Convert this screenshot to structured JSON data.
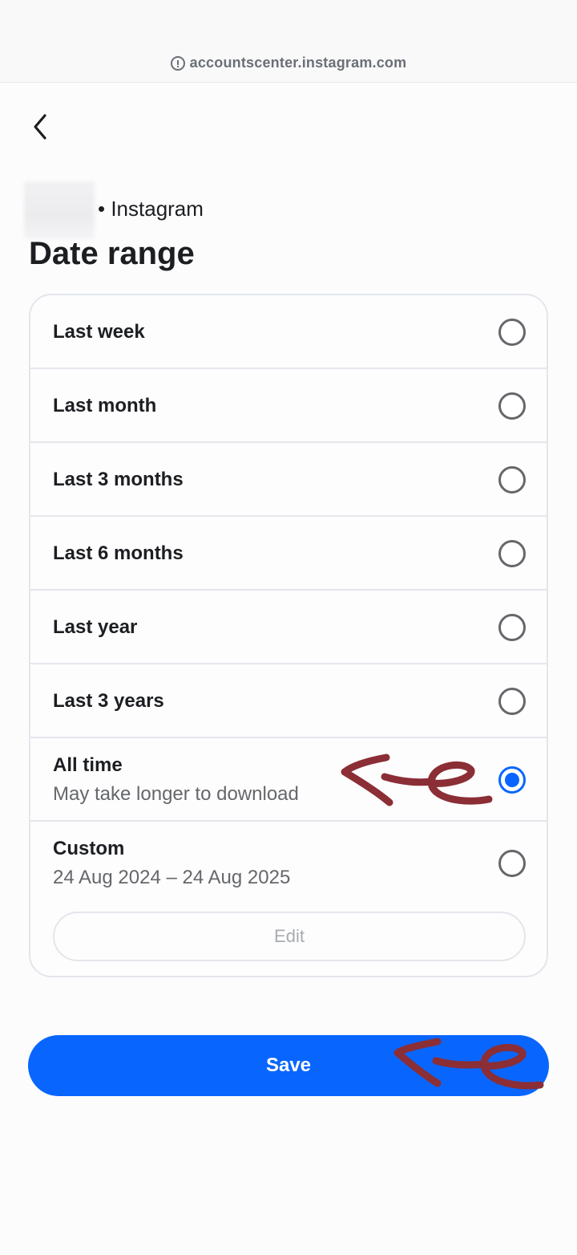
{
  "browser": {
    "url": "accountscenter.instagram.com",
    "info_icon": "info-icon"
  },
  "header": {
    "back_icon": "chevron-left-icon",
    "account_line": "• Instagram",
    "title": "Date range"
  },
  "options": [
    {
      "label": "Last week",
      "sublabel": "",
      "selected": false
    },
    {
      "label": "Last month",
      "sublabel": "",
      "selected": false
    },
    {
      "label": "Last 3 months",
      "sublabel": "",
      "selected": false
    },
    {
      "label": "Last 6 months",
      "sublabel": "",
      "selected": false
    },
    {
      "label": "Last year",
      "sublabel": "",
      "selected": false
    },
    {
      "label": "Last 3 years",
      "sublabel": "",
      "selected": false
    },
    {
      "label": "All time",
      "sublabel": "May take longer to download",
      "selected": true
    },
    {
      "label": "Custom",
      "sublabel": "24 Aug 2024 – 24 Aug 2025",
      "selected": false
    }
  ],
  "custom": {
    "edit_label": "Edit",
    "edit_disabled": true
  },
  "actions": {
    "save_label": "Save"
  },
  "colors": {
    "accent": "#0866ff",
    "annotation": "#8b2e35"
  }
}
